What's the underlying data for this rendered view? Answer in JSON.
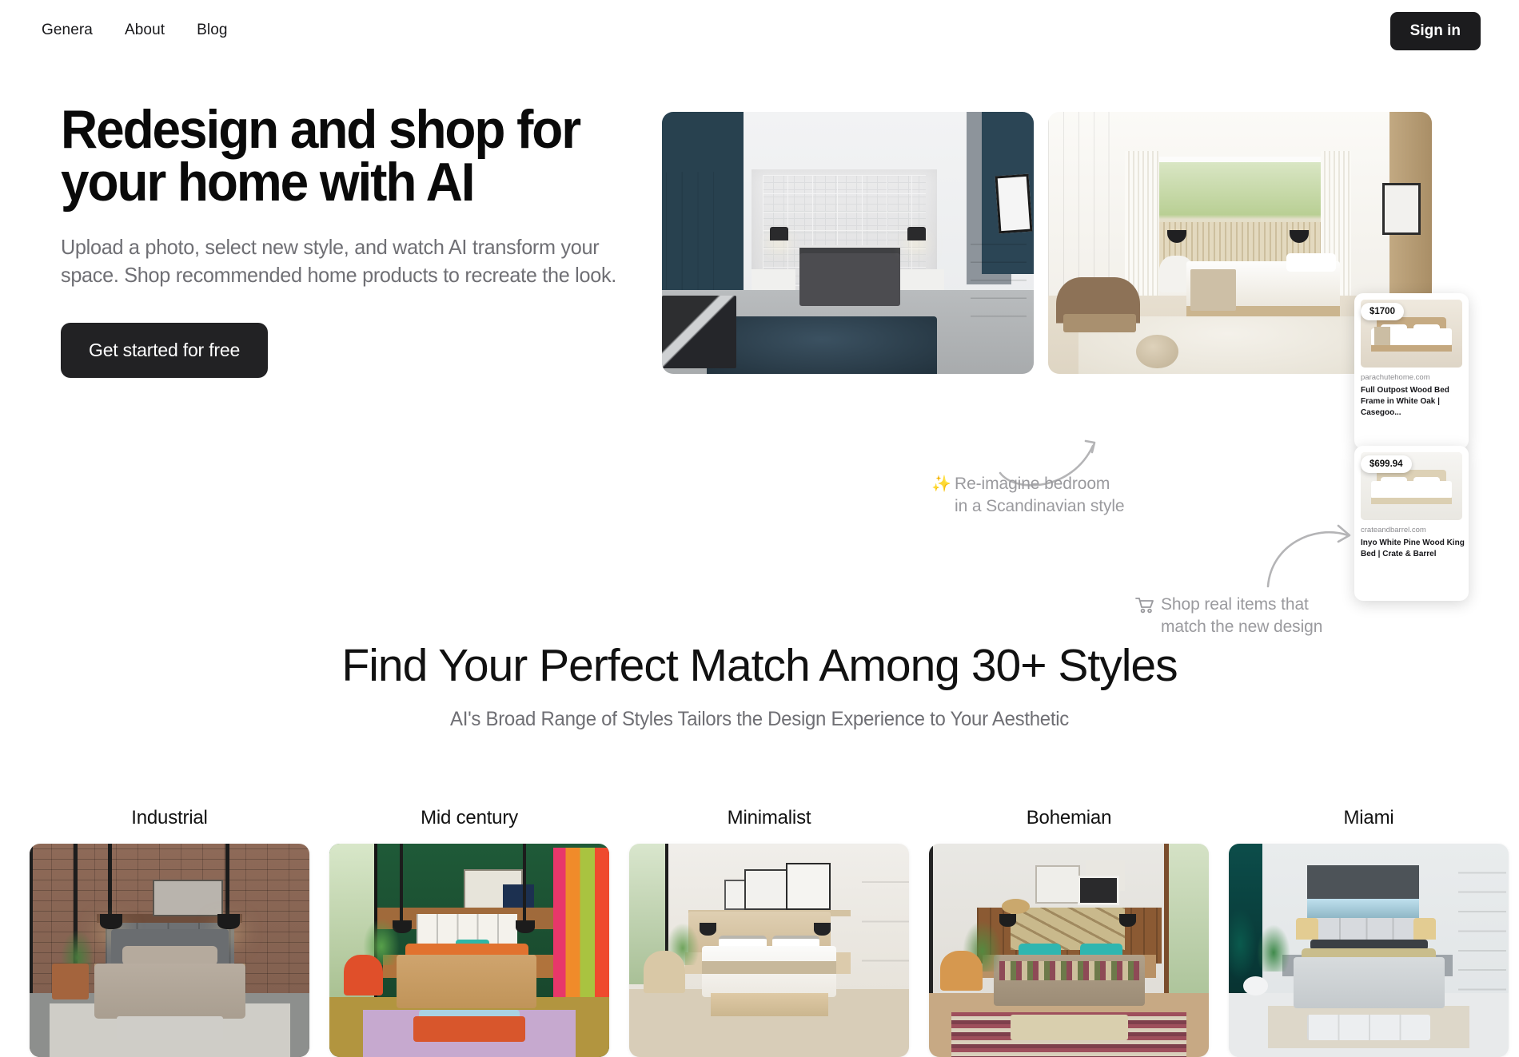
{
  "nav": {
    "links": [
      {
        "label": "Genera"
      },
      {
        "label": "About"
      },
      {
        "label": "Blog"
      }
    ],
    "signin_label": "Sign in"
  },
  "hero": {
    "headline": "Redesign and shop for\nyour home with AI",
    "subtext": "Upload a photo, select new style, and watch AI transform your\nspace. Shop recommended home products to recreate the look.",
    "cta_label": "Get started for free",
    "annotations": [
      {
        "icon": "✨",
        "text": "Re-imagine bedroom\nin a Scandinavian style"
      },
      {
        "icon": "cart",
        "text": "Shop real items that\nmatch the new design"
      }
    ],
    "products": [
      {
        "price": "$1700",
        "domain": "parachutehome.com",
        "title": "Full Outpost Wood Bed Frame in White Oak | Casegoo..."
      },
      {
        "price": "$699.94",
        "domain": "crateandbarrel.com",
        "title": "Inyo White Pine Wood King Bed | Crate & Barrel"
      }
    ]
  },
  "styles_section": {
    "title": "Find Your Perfect Match Among 30+ Styles",
    "subtitle": "AI's Broad Range of Styles Tailors the Design Experience to Your Aesthetic",
    "cards": [
      {
        "label": "Industrial"
      },
      {
        "label": "Mid century"
      },
      {
        "label": "Minimalist"
      },
      {
        "label": "Bohemian"
      },
      {
        "label": "Miami"
      }
    ]
  },
  "colors": {
    "accent_dark": "#1c1c1e",
    "muted_text": "#6f6f74",
    "annotation_text": "#9a9a9e"
  }
}
